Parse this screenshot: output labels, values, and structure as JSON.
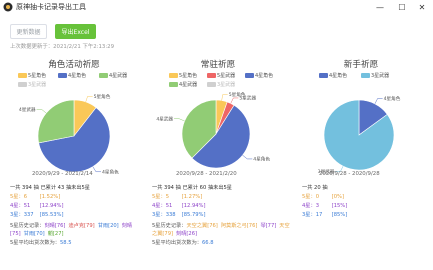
{
  "window": {
    "title": "原神抽卡记录导出工具",
    "min": "—",
    "max": "☐",
    "close": "✕"
  },
  "toolbar": {
    "refresh_label": "更新数据",
    "export_label": "导出Excel",
    "last_update": "上次数据更新于：2021/2/21 下午2:13:29"
  },
  "legend": {
    "five_char": "5星角色",
    "four_char": "4星角色",
    "four_weapon": "4星武器",
    "three_weapon": "3星武器",
    "five_weapon": "5星武器"
  },
  "colors": {
    "five_char": "#fac858",
    "four_char": "#5470c6",
    "four_weapon": "#91cc75",
    "three_weapon": "#73c0de",
    "five_weapon": "#ee6666",
    "three_weapon_off": "#d0d0d0"
  },
  "pools": [
    {
      "title": "角色活动祈愿",
      "date_range": "2020/9/29  -  2021/2/14",
      "chart_data": {
        "type": "pie",
        "slices": [
          {
            "name": "5星角色",
            "value": 6
          },
          {
            "name": "4星角色",
            "value": 35
          },
          {
            "name": "4星武器",
            "value": 16
          },
          {
            "name": "3星武器",
            "value": 337
          }
        ],
        "hidden_series": [
          "3星武器"
        ]
      },
      "stats": {
        "total_prefix": "一共",
        "total": "394",
        "total_mid": "抽 已累计",
        "since": "43",
        "total_suffix": "抽未出5星",
        "five_label": "5星：",
        "five_count": "6",
        "five_pct": "[1.52%]",
        "four_label": "4星：",
        "four_count": "51",
        "four_pct": "[12.94%]",
        "three_label": "3星：",
        "three_count": "337",
        "three_pct": "[85.53%]",
        "history_label": "5星历史记录：",
        "history": [
          {
            "name": "刻晴[76]",
            "color": "c-purple"
          },
          {
            "name": "迪卢克[79]",
            "color": "c-red"
          },
          {
            "name": "甘雨[20]",
            "color": "c-blue"
          },
          {
            "name": "刻晴[75]",
            "color": "c-purple"
          },
          {
            "name": "甘雨[70]",
            "color": "c-blue"
          },
          {
            "name": "魈[27]",
            "color": "c-green"
          }
        ],
        "avg_label": "5星平均出货次数为：",
        "avg": "58.5"
      }
    },
    {
      "title": "常驻祈愿",
      "date_range": "2020/9/28  -  2021/2/20",
      "chart_data": {
        "type": "pie",
        "slices": [
          {
            "name": "5星角色",
            "value": 3
          },
          {
            "name": "5星武器",
            "value": 2
          },
          {
            "name": "4星角色",
            "value": 30
          },
          {
            "name": "4星武器",
            "value": 21
          },
          {
            "name": "3星武器",
            "value": 338
          }
        ],
        "hidden_series": [
          "3星武器"
        ]
      },
      "stats": {
        "total_prefix": "一共",
        "total": "394",
        "total_mid": "抽 已累计",
        "since": "60",
        "total_suffix": "抽未出5星",
        "five_label": "5星：",
        "five_count": "5",
        "five_pct": "[1.27%]",
        "four_label": "4星：",
        "four_count": "51",
        "four_pct": "[12.94%]",
        "three_label": "3星：",
        "three_count": "338",
        "three_pct": "[85.79%]",
        "history_label": "5星历史记录：",
        "history": [
          {
            "name": "天空之翼[76]",
            "color": "c-gold"
          },
          {
            "name": "阿莫斯之弓[76]",
            "color": "c-gold"
          },
          {
            "name": "琴[77]",
            "color": "c-purple"
          },
          {
            "name": "天空之翼[79]",
            "color": "c-gold"
          },
          {
            "name": "刻晴[26]",
            "color": "c-purple"
          }
        ],
        "avg_label": "5星平均出货次数为：",
        "avg": "66.8"
      }
    },
    {
      "title": "新手祈愿",
      "date_range": "2020/9/28  -  2020/9/28",
      "chart_data": {
        "type": "pie",
        "slices": [
          {
            "name": "4星角色",
            "value": 3
          },
          {
            "name": "3星武器",
            "value": 17
          }
        ],
        "hidden_series": []
      },
      "stats": {
        "total_prefix": "一共",
        "total": "20",
        "total_mid": "抽",
        "since": "",
        "total_suffix": "",
        "five_label": "5星：",
        "five_count": "0",
        "five_pct": "[0%]",
        "four_label": "4星：",
        "four_count": "3",
        "four_pct": "[15%]",
        "three_label": "3星：",
        "three_count": "17",
        "three_pct": "[85%]",
        "history_label": "",
        "history": [],
        "avg_label": "",
        "avg": ""
      }
    }
  ]
}
